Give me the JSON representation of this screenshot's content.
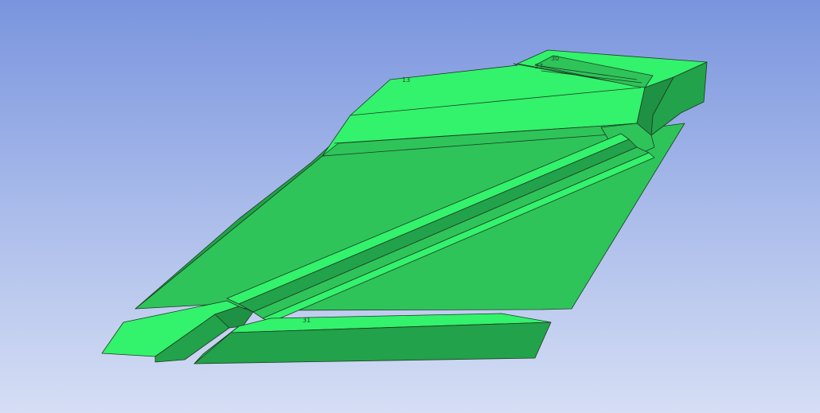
{
  "viewport": {
    "background_top": "#7a95de",
    "background_bottom": "#d5def4"
  },
  "model": {
    "face_colors": {
      "bright": "#33f26c",
      "medium": "#2ec45a",
      "dark": "#22a24a",
      "darker": "#1e9144",
      "edge": "#1e3b22"
    }
  },
  "labels": {
    "a": "13",
    "b": "30",
    "c": "27",
    "d": "31"
  }
}
